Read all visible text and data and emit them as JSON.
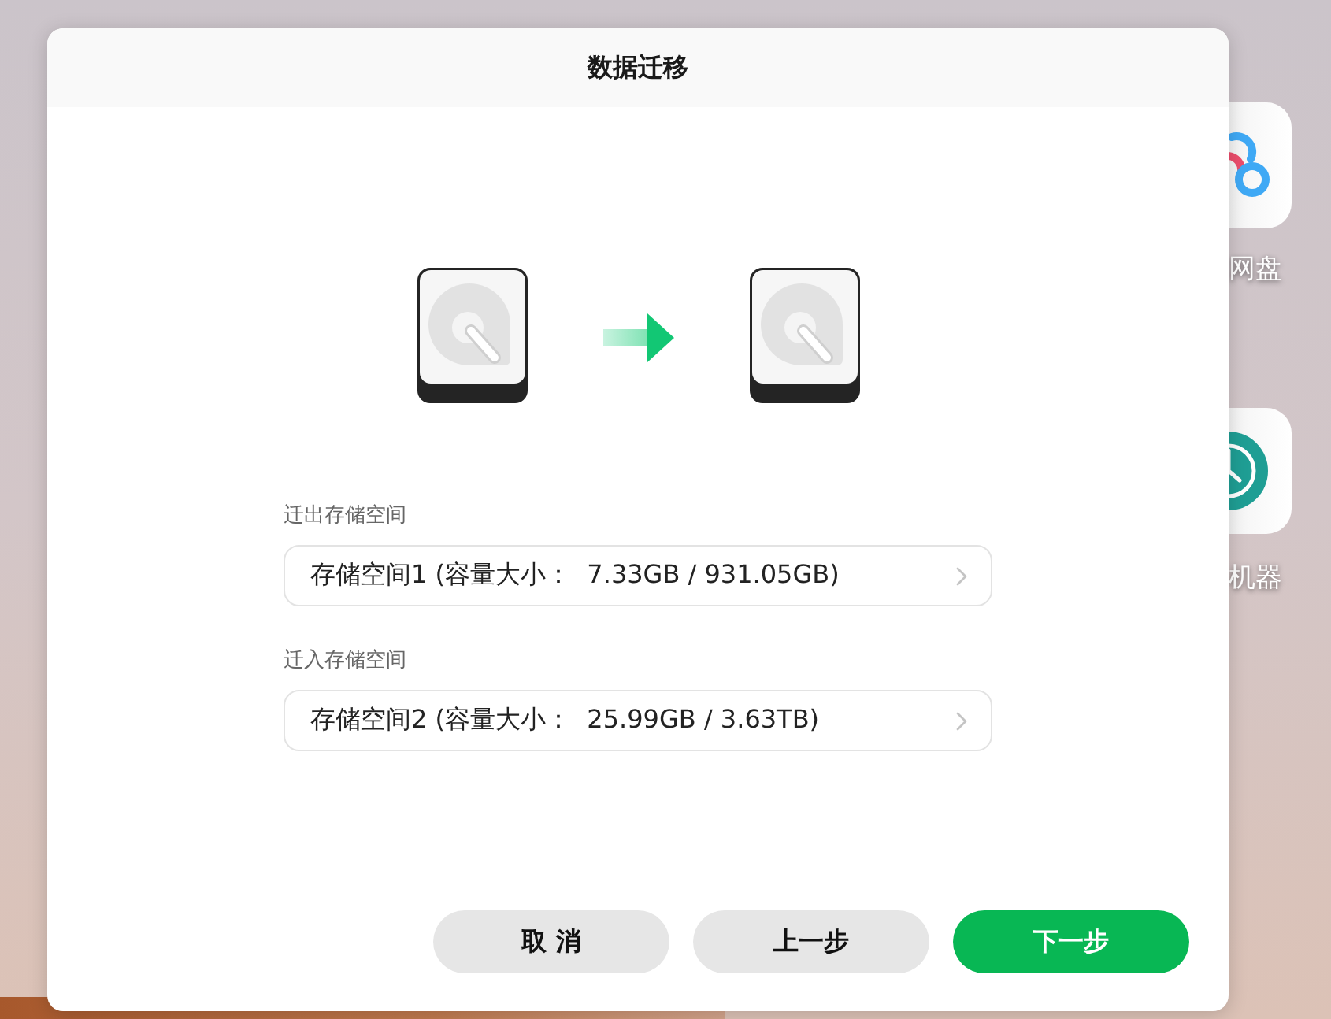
{
  "desktop_icons": [
    {
      "kind": "cloud",
      "label": "网盘"
    },
    {
      "kind": "clock",
      "label": "机器"
    }
  ],
  "dialog": {
    "title": "数据迁移",
    "fields": [
      {
        "label": "迁出存储空间",
        "value": "存储空间1 (容量大小：  7.33GB / 931.05GB)"
      },
      {
        "label": "迁入存储空间",
        "value": "存储空间2 (容量大小：  25.99GB / 3.63TB)"
      }
    ],
    "buttons": [
      {
        "label": "取 消",
        "kind": "secondary"
      },
      {
        "label": "上一步",
        "kind": "secondary"
      },
      {
        "label": "下一步",
        "kind": "primary"
      }
    ]
  }
}
